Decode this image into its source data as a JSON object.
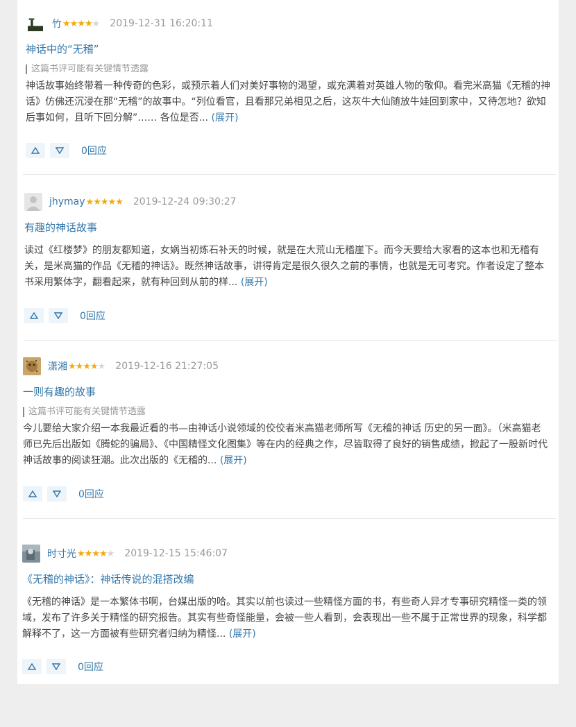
{
  "reviews": [
    {
      "user": "竹",
      "rating": 4,
      "date": "2019-12-31 16:20:11",
      "title": "神话中的“无稽”",
      "spoiler": "这篇书评可能有关键情节透露",
      "body": "神话故事始终带着一种传奇的色彩，或预示着人们对美好事物的渴望，或充满着对英雄人物的敬仰。看完米高猫《无稽的神话》仿佛还沉浸在那“无稽”的故事中。“列位看官，且看那兄弟相见之后，这灰牛大仙随放牛娃回到家中，又待怎地？欲知后事如何，且听下回分解”…… 各位是否...",
      "expand": "(展开)",
      "replies": "0回应"
    },
    {
      "user": "jhymay",
      "rating": 5,
      "date": "2019-12-24 09:30:27",
      "title": "有趣的神话故事",
      "spoiler": "",
      "body": "读过《红楼梦》的朋友都知道，女娲当初炼石补天的时候，就是在大荒山无稽崖下。而今天要给大家看的这本也和无稽有关，是米高猫的作品《无稽的神话》。既然神话故事，讲得肯定是很久很久之前的事情，也就是无可考究。作者设定了整本书采用繁体字，翻看起来，就有种回到从前的样...",
      "expand": "(展开)",
      "replies": "0回应"
    },
    {
      "user": "潇湘",
      "rating": 4,
      "date": "2019-12-16 21:27:05",
      "title": "一则有趣的故事",
      "spoiler": "这篇书评可能有关键情节透露",
      "body": "今儿要给大家介绍一本我最近看的书—由神话小说领域的佼佼者米高猫老师所写《无稽的神话 历史的另一面》。（米高猫老师已先后出版如《腾蛇的骗局》、《中国精怪文化图集》等在内的经典之作，尽皆取得了良好的销售成绩，掀起了一股新时代神话故事的阅读狂潮。此次出版的《无稽的...",
      "expand": "(展开)",
      "replies": "0回应"
    },
    {
      "user": "时寸光",
      "rating": 4,
      "date": "2019-12-15 15:46:07",
      "title": "《无稽的神话》：神话传说的混搭改编",
      "spoiler": "",
      "body": "《无稽的神话》是一本繁体书啊，台媒出版的哈。其实以前也读过一些精怪方面的书，有些奇人异才专事研究精怪一类的领域，发布了许多关于精怪的研究报告。其实有些奇怪能量，会被一些人看到，会表现出一些不属于正常世界的现象，科学都解释不了，这一方面被有些研究者归纳为精怪...",
      "expand": "(展开)",
      "replies": "0回应"
    }
  ],
  "colors": {
    "link": "#3377aa",
    "star": "#f4a90b",
    "vote_bg": "#edf4fa"
  }
}
